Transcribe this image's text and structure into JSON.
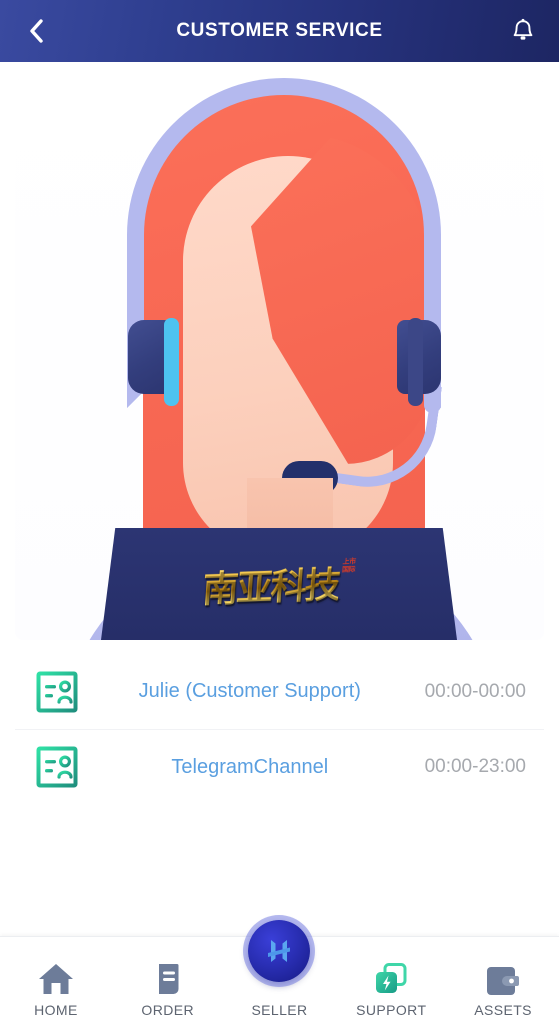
{
  "header": {
    "title": "CUSTOMER SERVICE",
    "back_icon": "chevron-left-icon",
    "bell_icon": "bell-icon",
    "bg_color_left": "#3a4aa0",
    "bg_color_right": "#1d2663"
  },
  "hero": {
    "alt": "customer support agent with headset at laptop",
    "logo_text": "南亚科技",
    "logo_sub_line1": "上市",
    "logo_sub_line2": "国际",
    "logo_color": "#f3c64b",
    "laptop_color": "#2a3070",
    "shirt_color": "#aeb3ea",
    "hair_color": "#f96a55",
    "headset_band_color": "#b4b9ee",
    "earcup_color": "#333e7d",
    "earcup_accent_color": "#4dc3f0",
    "skin_color": "#f8c4ae"
  },
  "contacts": {
    "icon_name": "contact-card-icon",
    "icon_color": "#2bbd8f",
    "name_color": "#5a9fe0",
    "time_color": "#a6a9ae",
    "items": [
      {
        "name": "Julie (Customer Support)",
        "hours": "00:00-00:00"
      },
      {
        "name": "TelegramChannel",
        "hours": "00:00-23:00"
      }
    ]
  },
  "tabbar": {
    "active": "SUPPORT",
    "items": [
      {
        "label": "HOME",
        "icon": "home-icon",
        "color": "#6d7c99"
      },
      {
        "label": "ORDER",
        "icon": "order-icon",
        "color": "#6d7c99"
      },
      {
        "label": "SELLER",
        "icon": "seller-icon",
        "color": "#2a2fb5"
      },
      {
        "label": "SUPPORT",
        "icon": "support-icon",
        "color": "#2bbd8f"
      },
      {
        "label": "ASSETS",
        "icon": "wallet-icon",
        "color": "#6d7c99"
      }
    ]
  }
}
